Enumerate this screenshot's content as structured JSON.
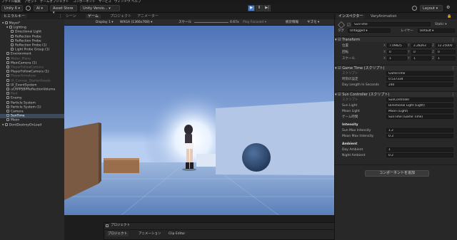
{
  "menubar": {
    "items": [
      "ファイル",
      "編集",
      "アセット",
      "ゲームオブジェクト",
      "コンポーネント",
      "サービス",
      "ウィンドウ",
      "ヘルプ"
    ]
  },
  "toolbar": {
    "account": "Unity 6 ▾",
    "ai": "AI ▾",
    "asset_store": "Asset Store ▾",
    "version_control": "Unity Versio... ▾",
    "play": "▶",
    "pause": "Ⅱ",
    "step": "▶|",
    "layout": "Layout ▾"
  },
  "hierarchy": {
    "tab": "ヒエラルキー",
    "rows": [
      {
        "label": "Mayoi*",
        "indent": 0,
        "state": "root"
      },
      {
        "label": "Lighting",
        "indent": 1,
        "state": "normal"
      },
      {
        "label": "Directional Light",
        "indent": 2,
        "state": "normal"
      },
      {
        "label": "Reflection Probe",
        "indent": 2,
        "state": "normal"
      },
      {
        "label": "Reflection Probe",
        "indent": 2,
        "state": "normal"
      },
      {
        "label": "Reflection Probe (1)",
        "indent": 2,
        "state": "normal"
      },
      {
        "label": "Light Probe Group (1)",
        "indent": 2,
        "state": "normal"
      },
      {
        "label": "Environment",
        "indent": 1,
        "state": "normal"
      },
      {
        "label": "Water_Plane",
        "indent": 1,
        "state": "dim"
      },
      {
        "label": "MainCamera (1)",
        "indent": 1,
        "state": "normal"
      },
      {
        "label": "PlayerFollowCamera",
        "indent": 1,
        "state": "dim"
      },
      {
        "label": "PlayerFollowCamera (1)",
        "indent": 1,
        "state": "normal"
      },
      {
        "label": "PlayerArmature",
        "indent": 1,
        "state": "dim"
      },
      {
        "label": "UI_Canvas_StarterAssets",
        "indent": 1,
        "state": "dim"
      },
      {
        "label": "UI_EventSystem",
        "indent": 1,
        "state": "normal"
      },
      {
        "label": "uCRPPSBPReflectionVolume",
        "indent": 1,
        "state": "normal"
      },
      {
        "label": "Post",
        "indent": 1,
        "state": "dim"
      },
      {
        "label": "Enemy",
        "indent": 1,
        "state": "normal"
      },
      {
        "label": "Particle System",
        "indent": 1,
        "state": "normal"
      },
      {
        "label": "Particle System (1)",
        "indent": 1,
        "state": "normal"
      },
      {
        "label": "Camera",
        "indent": 1,
        "state": "normal"
      },
      {
        "label": "SunTime",
        "indent": 1,
        "state": "selected"
      },
      {
        "label": "Moon",
        "indent": 1,
        "state": "normal"
      },
      {
        "label": "DontDestroyOnLoad",
        "indent": 0,
        "state": "root"
      }
    ]
  },
  "scene": {
    "tabs": [
      "シーン",
      "ゲーム",
      "プロジェクト",
      "アニメーター"
    ],
    "active_tab": "ゲーム",
    "display": "Display 1 ▾",
    "resolution": "WXGA (1366x768) ▾",
    "scale_label": "スケール",
    "scale_value": "0.67x",
    "play_mode": "Play Focused ▾",
    "stats": "統計情報",
    "gizmos": "ギズモ ▾"
  },
  "project_panel": {
    "title": "プロジェクト",
    "tabs": [
      "プロジェクト",
      "アニメーション",
      "Clip Editor"
    ]
  },
  "inspector": {
    "tabs": [
      "インスペクター",
      "VaryAnimation"
    ],
    "object_name": "SunTime",
    "static_label": "Static ▾",
    "tag_label": "タグ",
    "tag_value": "Untagged ▾",
    "layer_label": "レイヤー",
    "layer_value": "Default ▾",
    "transform": {
      "title": "Transform",
      "rows": [
        {
          "label": "位置",
          "x": "7.09825",
          "y": "2.28263",
          "z": "12.25000"
        },
        {
          "label": "回転",
          "x": "0",
          "y": "0",
          "z": "0"
        },
        {
          "label": "スケール",
          "x": "1",
          "y": "1",
          "z": "1"
        }
      ]
    },
    "game_time": {
      "title": "Game Time (スクリプト)",
      "rows": [
        {
          "label": "スクリプト",
          "value": "GameTime"
        },
        {
          "label": "時刻の設定",
          "value": "0.537334"
        },
        {
          "label": "Day Length In Seconds",
          "value": "240"
        }
      ]
    },
    "sun_controller": {
      "title": "Sun Controller (スクリプト)",
      "rows": [
        {
          "label": "スクリプト",
          "value": "SunController"
        },
        {
          "label": "Sun Light",
          "value": "Directional Light (Light)"
        },
        {
          "label": "Moon Light",
          "value": "Moon (Light)"
        },
        {
          "label": "ゲーム時間",
          "value": "SunTime (Game Time)"
        }
      ],
      "intensity_header": "Intensity",
      "intensity_rows": [
        {
          "label": "Sun Max Intensity",
          "value": "1.2"
        },
        {
          "label": "Moon Max Intensity",
          "value": "0.3"
        }
      ],
      "ambient_header": "Ambient",
      "ambient_rows": [
        {
          "label": "Day Ambient",
          "value": "1"
        },
        {
          "label": "Night Ambient",
          "value": "0.2"
        }
      ]
    },
    "add_component": "コンポーネントを追加"
  },
  "colors": {
    "accent": "#4c7fd0",
    "selection": "#3c4a5c",
    "panel": "#282828"
  }
}
